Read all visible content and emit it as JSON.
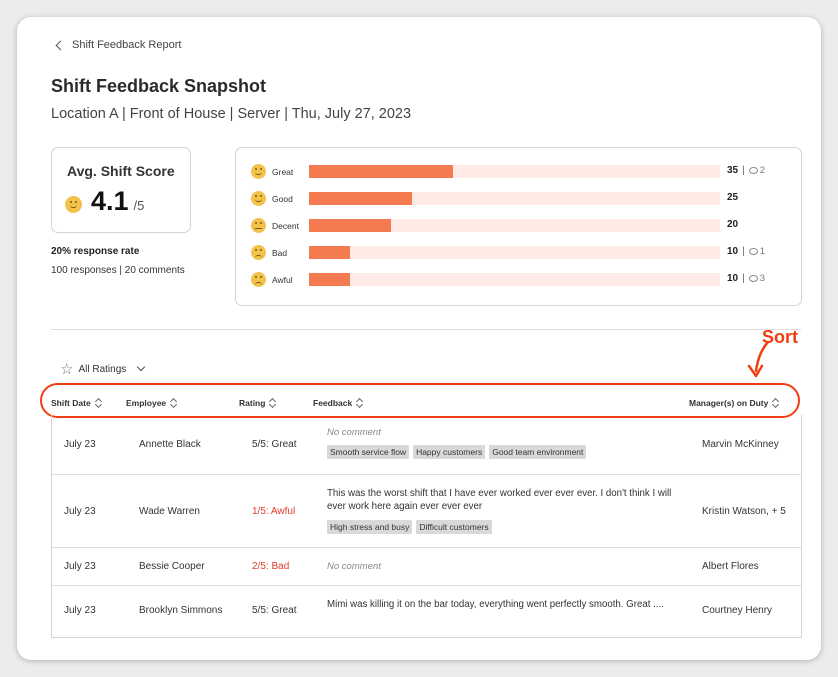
{
  "breadcrumb": {
    "back_label": "Shift Feedback Report"
  },
  "page": {
    "title": "Shift Feedback Snapshot",
    "subtitle": "Location A | Front of House | Server | Thu, July 27, 2023"
  },
  "score": {
    "label": "Avg. Shift Score",
    "value": "4.1",
    "max": "/5",
    "response_rate": "20% response rate",
    "responses": "100 responses | 20 comments"
  },
  "distribution": [
    {
      "label": "Great",
      "count": "35",
      "sep": "|",
      "comments": "2",
      "fraction": 0.35,
      "mood": "happy"
    },
    {
      "label": "Good",
      "count": "25",
      "sep": "",
      "comments": "",
      "fraction": 0.25,
      "mood": "happy"
    },
    {
      "label": "Decent",
      "count": "20",
      "sep": "",
      "comments": "",
      "fraction": 0.2,
      "mood": "flat"
    },
    {
      "label": "Bad",
      "count": "10",
      "sep": "|",
      "comments": "1",
      "fraction": 0.1,
      "mood": "sad"
    },
    {
      "label": "Awful",
      "count": "10",
      "sep": "|",
      "comments": "3",
      "fraction": 0.1,
      "mood": "sad"
    }
  ],
  "filter": {
    "label": "All Ratings"
  },
  "annotation": {
    "sort_label": "Sort",
    "color": "#f03e12"
  },
  "table": {
    "headers": {
      "date": "Shift Date",
      "employee": "Employee",
      "rating": "Rating",
      "feedback": "Feedback",
      "managers": "Manager(s) on Duty"
    },
    "rows": [
      {
        "date": "July 23",
        "employee": "Annette Black",
        "rating": "5/5: Great",
        "negative": false,
        "feedback": "No comment",
        "no_comment": true,
        "tags": [
          "Smooth service flow",
          "Happy customers",
          "Good team environment"
        ],
        "manager": "Marvin McKinney"
      },
      {
        "date": "July 23",
        "employee": "Wade Warren",
        "rating": "1/5: Awful",
        "negative": true,
        "feedback": "This was the worst shift that I have ever worked ever ever ever. I don't think I will ever work here again ever ever ever",
        "no_comment": false,
        "tags": [
          "High stress and busy",
          "Difficult customers"
        ],
        "manager": "Kristin Watson, + 5"
      },
      {
        "date": "July 23",
        "employee": "Bessie Cooper",
        "rating": "2/5: Bad",
        "negative": true,
        "feedback": "No comment",
        "no_comment": true,
        "tags": [],
        "manager": "Albert Flores"
      },
      {
        "date": "July 23",
        "employee": "Brooklyn Simmons",
        "rating": "5/5: Great",
        "negative": false,
        "feedback": "Mimi was killing it on the bar today, everything went perfectly smooth. Great ....",
        "no_comment": false,
        "tags": [],
        "manager": "Courtney Henry"
      }
    ]
  },
  "colors": {
    "bar": "#f47a4f",
    "track": "#fdeae4",
    "negative_rating": "#e23c2c"
  }
}
